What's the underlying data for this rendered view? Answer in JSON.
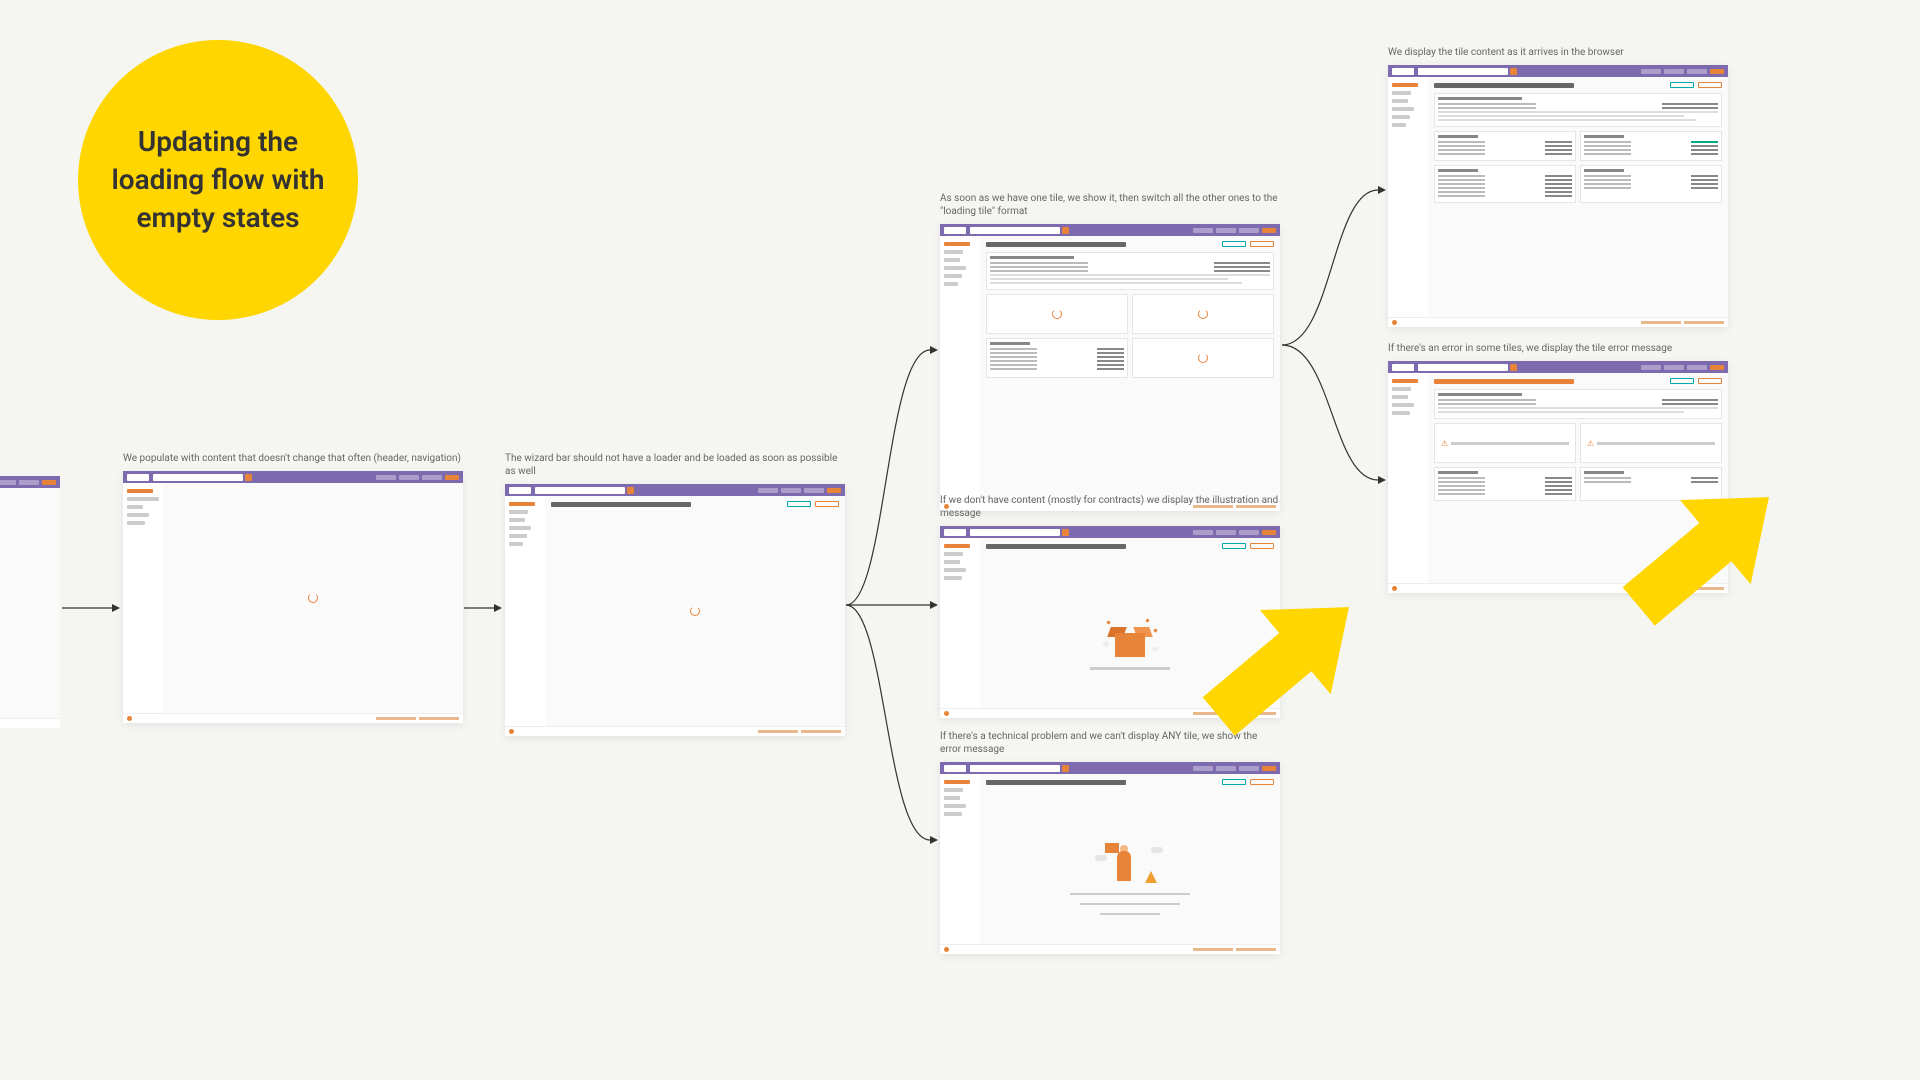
{
  "title": "Updating the loading flow with empty states",
  "stages": {
    "s1": {
      "caption": "We populate with content that doesn't change that often (header, navigation)"
    },
    "s2": {
      "caption": "The wizard bar should not have a loader and be loaded as soon as possible as well"
    },
    "s3a": {
      "caption": "As soon as we have one tile, we show it, then switch all the other ones to the \"loading tile\" format"
    },
    "s3b": {
      "caption": "If we don't have content (mostly for contracts) we display the illustration and message"
    },
    "s3c": {
      "caption": "If there's a technical problem and we can't display ANY tile, we show the error message"
    },
    "s4a": {
      "caption": "We display the tile content as it arrives in the browser"
    },
    "s4b": {
      "caption": "If there's an error in some tiles, we display the tile error message"
    }
  },
  "colors": {
    "accent": "#ffd600",
    "purple": "#7e6aae",
    "orange": "#e8833a"
  }
}
